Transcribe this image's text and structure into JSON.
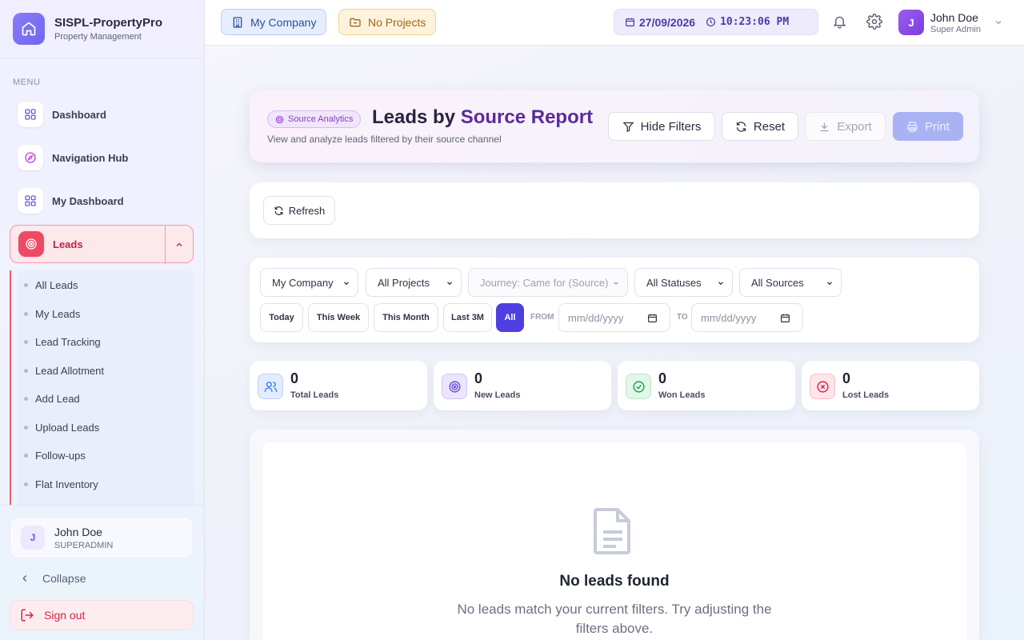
{
  "brand": {
    "name": "SISPL-PropertyPro",
    "subtitle": "Property Management",
    "icon": "home-icon"
  },
  "sidebar": {
    "menu_label": "MENU",
    "items": [
      {
        "label": "Dashboard",
        "icon": "grid-icon"
      },
      {
        "label": "Navigation Hub",
        "icon": "compass-icon"
      },
      {
        "label": "My Dashboard",
        "icon": "grid-icon"
      },
      {
        "label": "Leads",
        "icon": "target-icon",
        "active": true
      }
    ],
    "leads_submenu": [
      "All Leads",
      "My Leads",
      "Lead Tracking",
      "Lead Allotment",
      "Add Lead",
      "Upload Leads",
      "Follow-ups",
      "Flat Inventory"
    ],
    "user": {
      "initial": "J",
      "name": "John Doe",
      "role": "SUPERADMIN"
    },
    "collapse_label": "Collapse",
    "signout_label": "Sign out"
  },
  "header": {
    "company_chip": "My Company",
    "projects_chip": "No Projects",
    "date": "27/09/2026",
    "time": "10:23:06 PM",
    "user": {
      "initial": "J",
      "name": "John Doe",
      "role": "Super Admin"
    }
  },
  "report": {
    "badge": "Source Analytics",
    "title_part1": "Leads by ",
    "title_part2": "Source Report",
    "subtitle": "View and analyze leads filtered by their source channel",
    "buttons": {
      "hide_filters": "Hide Filters",
      "reset": "Reset",
      "export": "Export",
      "print": "Print"
    }
  },
  "refresh_label": "Refresh",
  "filters": {
    "company": "My Company",
    "projects": "All Projects",
    "journey": "Journey: Came for (Source)",
    "statuses": "All Statuses",
    "sources": "All Sources",
    "ranges": [
      "Today",
      "This Week",
      "This Month",
      "Last 3M",
      "All"
    ],
    "active_range": "All",
    "from_label": "FROM",
    "to_label": "TO",
    "date_placeholder": "mm/dd/yyyy"
  },
  "stats": [
    {
      "value": "0",
      "label": "Total Leads",
      "icon": "users-icon",
      "color": "#3b82f6"
    },
    {
      "value": "0",
      "label": "New Leads",
      "icon": "target-icon",
      "color": "#6b4fd8"
    },
    {
      "value": "0",
      "label": "Won Leads",
      "icon": "check-circle-icon",
      "color": "#16a34a"
    },
    {
      "value": "0",
      "label": "Lost Leads",
      "icon": "x-circle-icon",
      "color": "#e11d48"
    }
  ],
  "empty": {
    "title": "No leads found",
    "message": "No leads match your current filters. Try adjusting the filters above."
  },
  "colors": {
    "accent": "#4f3fe0",
    "leads_red": "#ef4a63",
    "print": "#a9b3f4"
  }
}
